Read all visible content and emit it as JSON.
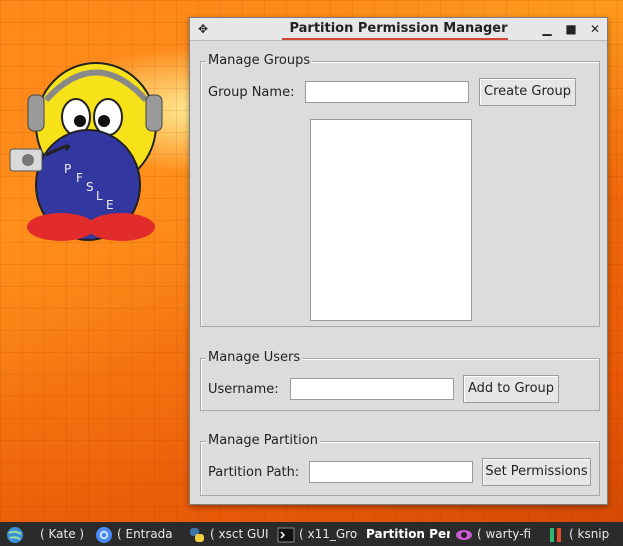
{
  "window": {
    "title": "Partition Permission Manager"
  },
  "manage_groups": {
    "legend": "Manage Groups",
    "group_name_label": "Group Name:",
    "group_name_value": "",
    "create_button": "Create Group",
    "groups_list": []
  },
  "manage_users": {
    "legend": "Manage Users",
    "username_label": "Username:",
    "username_value": "",
    "add_button": "Add to Group"
  },
  "manage_partition": {
    "legend": "Manage Partition",
    "path_label": "Partition Path:",
    "path_value": "",
    "set_button": "Set Permissions"
  },
  "wallpaper": {
    "mascot_letters": [
      "P",
      "F",
      "S",
      "L",
      "E"
    ]
  },
  "taskbar": {
    "items": [
      {
        "label": "( Kate )",
        "icon": "globe-icon"
      },
      {
        "label": "( Entrada",
        "icon": "chrome-icon"
      },
      {
        "label": "( xsct GUI",
        "icon": "python-icon"
      },
      {
        "label": "( x11_Gro",
        "icon": "terminal-icon"
      },
      {
        "label": "Partition Per",
        "icon": "none",
        "active": true
      },
      {
        "label": "( warty-fi",
        "icon": "eye-icon"
      },
      {
        "label": "( ksnip",
        "icon": "ksnip-icon"
      }
    ]
  },
  "colors": {
    "window_bg": "#dcdcdc",
    "title_accent": "#d44434",
    "taskbar_bg": "#2b2b2b",
    "wallpaper_orange": "#f57c12"
  }
}
